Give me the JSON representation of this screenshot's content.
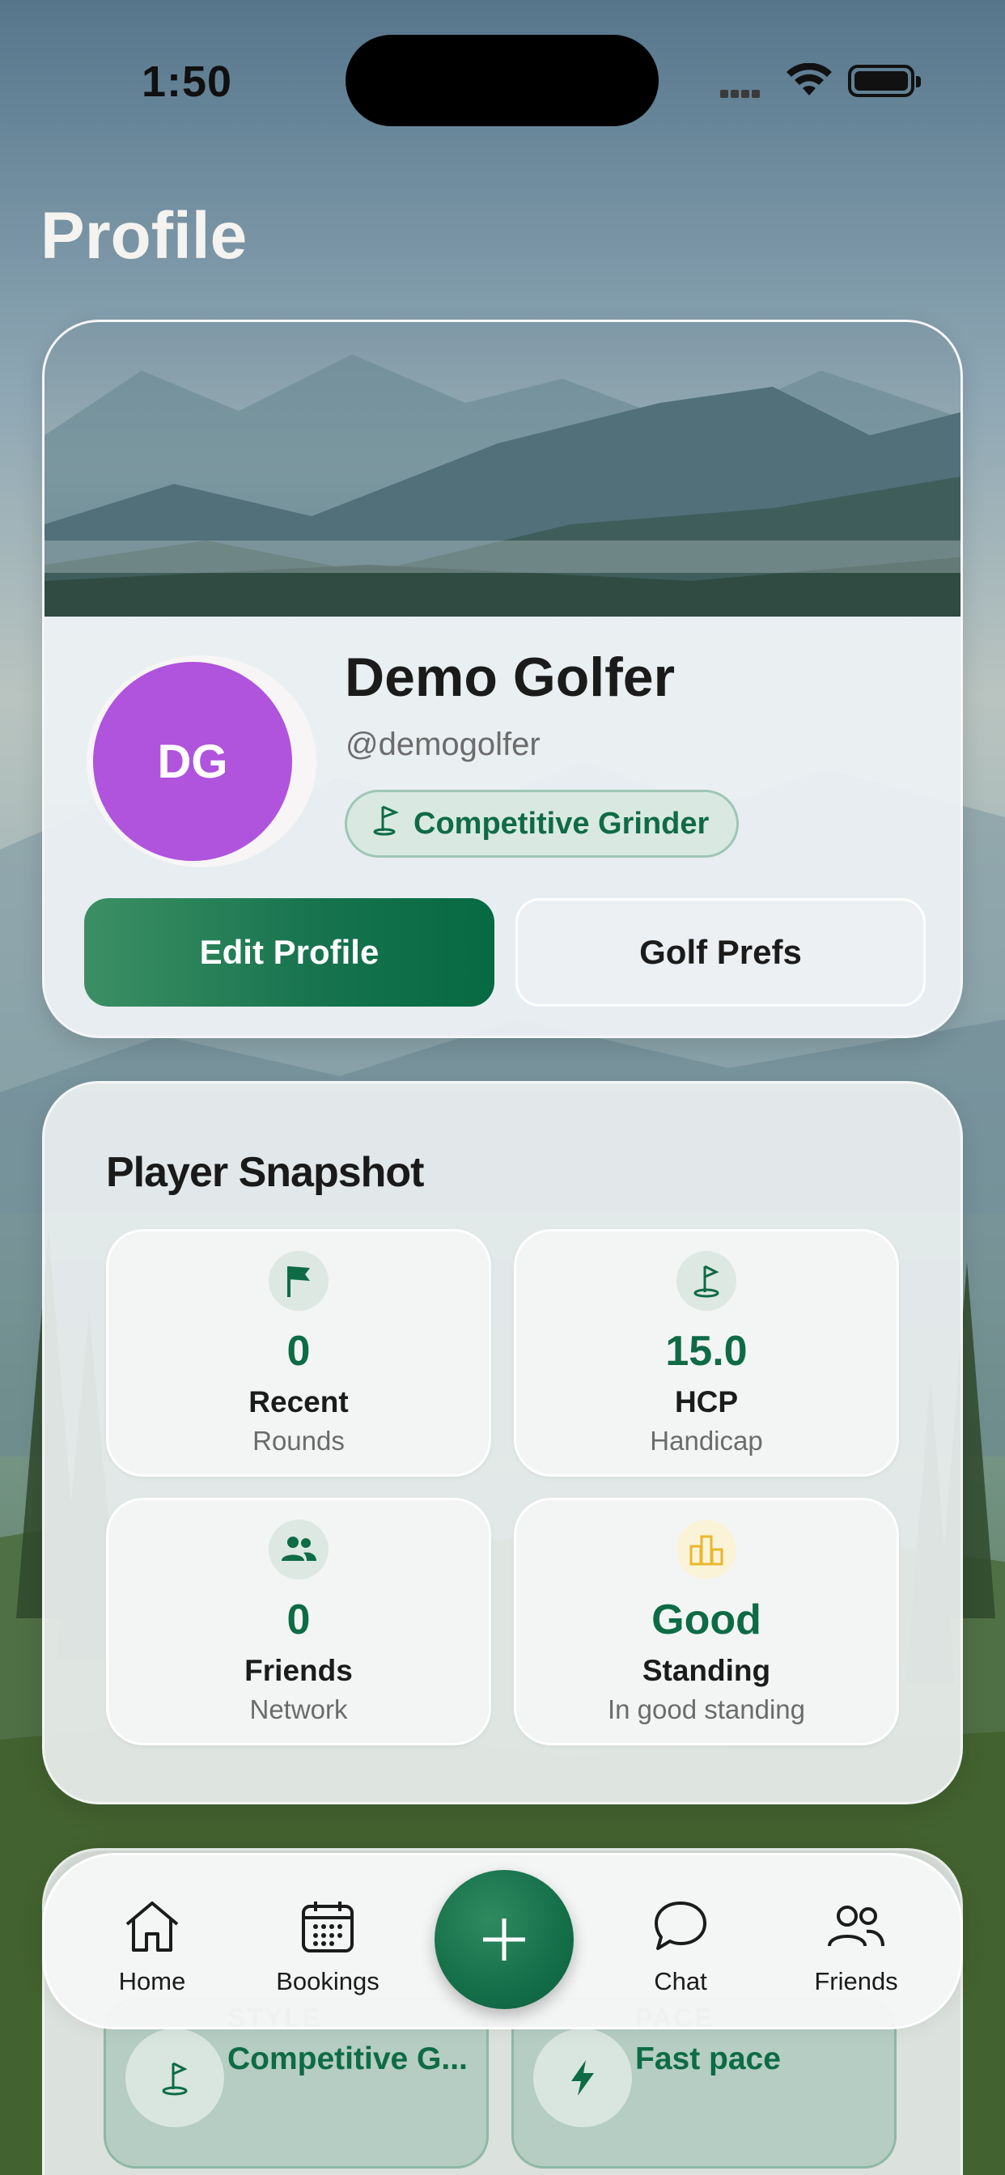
{
  "status_bar": {
    "time": "1:50"
  },
  "page": {
    "title": "Profile"
  },
  "profile": {
    "initials": "DG",
    "name": "Demo Golfer",
    "handle": "@demogolfer",
    "badge": "Competitive Grinder",
    "edit_label": "Edit Profile",
    "prefs_label": "Golf Prefs",
    "avatar_color": "#b053dd"
  },
  "snapshot": {
    "title": "Player Snapshot",
    "tiles": [
      {
        "value": "0",
        "label": "Recent",
        "sub": "Rounds",
        "icon": "flag-icon"
      },
      {
        "value": "15.0",
        "label": "HCP",
        "sub": "Handicap",
        "icon": "golf-flag-icon"
      },
      {
        "value": "0",
        "label": "Friends",
        "sub": "Network",
        "icon": "people-icon"
      },
      {
        "value": "Good",
        "label": "Standing",
        "sub": "In good standing",
        "icon": "leaderboard-icon"
      }
    ]
  },
  "preferences": [
    {
      "key": "STYLE",
      "value": "Competitive G...",
      "icon": "golf-flag-icon"
    },
    {
      "key": "PACE",
      "value": "Fast pace",
      "icon": "lightning-icon"
    }
  ],
  "nav": {
    "items": [
      {
        "label": "Home",
        "icon": "home-icon"
      },
      {
        "label": "Bookings",
        "icon": "calendar-icon"
      },
      {
        "label": "Chat",
        "icon": "chat-icon"
      },
      {
        "label": "Friends",
        "icon": "friends-icon"
      }
    ],
    "fab_icon": "plus-icon"
  },
  "colors": {
    "accent": "#0d6b45",
    "avatar": "#b053dd"
  }
}
